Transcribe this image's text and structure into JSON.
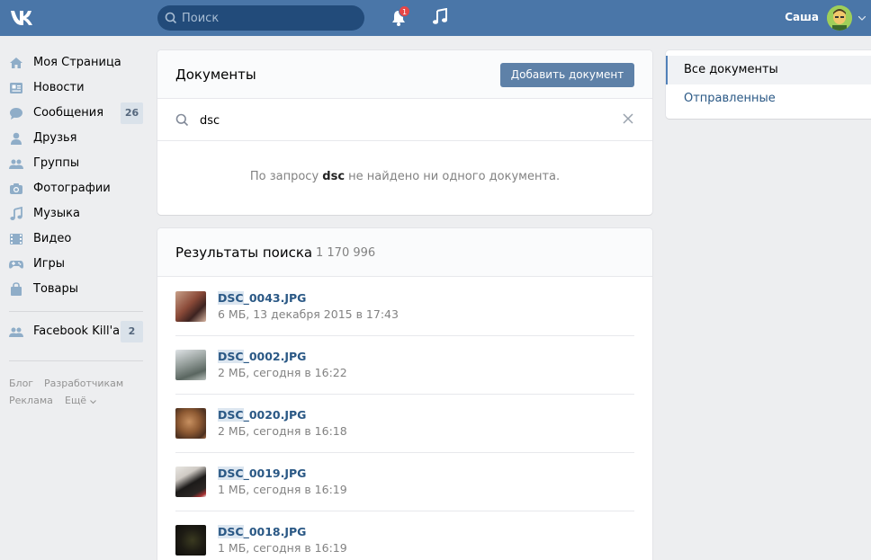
{
  "header": {
    "logo": "vk-logo",
    "search_placeholder": "Поиск",
    "notifications_count": "1",
    "user_name": "Саша"
  },
  "sidebar": {
    "items": [
      {
        "label": "Моя Страница",
        "icon": "home-icon"
      },
      {
        "label": "Новости",
        "icon": "news-icon"
      },
      {
        "label": "Сообщения",
        "icon": "messages-icon",
        "count": "26"
      },
      {
        "label": "Друзья",
        "icon": "friends-icon"
      },
      {
        "label": "Группы",
        "icon": "groups-icon"
      },
      {
        "label": "Фотографии",
        "icon": "camera-icon"
      },
      {
        "label": "Музыка",
        "icon": "music-icon"
      },
      {
        "label": "Видео",
        "icon": "video-icon"
      },
      {
        "label": "Игры",
        "icon": "gamepad-icon"
      },
      {
        "label": "Товары",
        "icon": "bag-icon"
      }
    ],
    "app": {
      "label": "Facebook Kill'a",
      "icon": "groups-icon",
      "count": "2"
    },
    "footer_links": [
      "Блог",
      "Разработчикам",
      "Реклама",
      "Ещё"
    ]
  },
  "documents": {
    "title": "Документы",
    "add_button": "Добавить документ",
    "query": "dsc",
    "empty_prefix": "По запросу ",
    "empty_query": "dsc",
    "empty_suffix": " не найдено ни одного документа."
  },
  "results": {
    "title": "Результаты поиска",
    "count": "1 170 996",
    "items": [
      {
        "name_highlight": "DSC",
        "name_rest": "_0043.JPG",
        "meta": "6 МБ, 13 декабря 2015 в 17:43"
      },
      {
        "name_highlight": "DSC",
        "name_rest": "_0002.JPG",
        "meta": "2 МБ, сегодня в 16:22"
      },
      {
        "name_highlight": "DSC",
        "name_rest": "_0020.JPG",
        "meta": "2 МБ, сегодня в 16:18"
      },
      {
        "name_highlight": "DSC",
        "name_rest": "_0019.JPG",
        "meta": "1 МБ, сегодня в 16:19"
      },
      {
        "name_highlight": "DSC",
        "name_rest": "_0018.JPG",
        "meta": "1 МБ, сегодня в 16:19"
      }
    ]
  },
  "filters": {
    "items": [
      {
        "label": "Все документы",
        "active": true
      },
      {
        "label": "Отправленные",
        "active": false
      }
    ]
  },
  "colors": {
    "header_bg": "#4a76a8",
    "link": "#2a5885",
    "button": "#5e81a8",
    "badge": "#e64646"
  }
}
